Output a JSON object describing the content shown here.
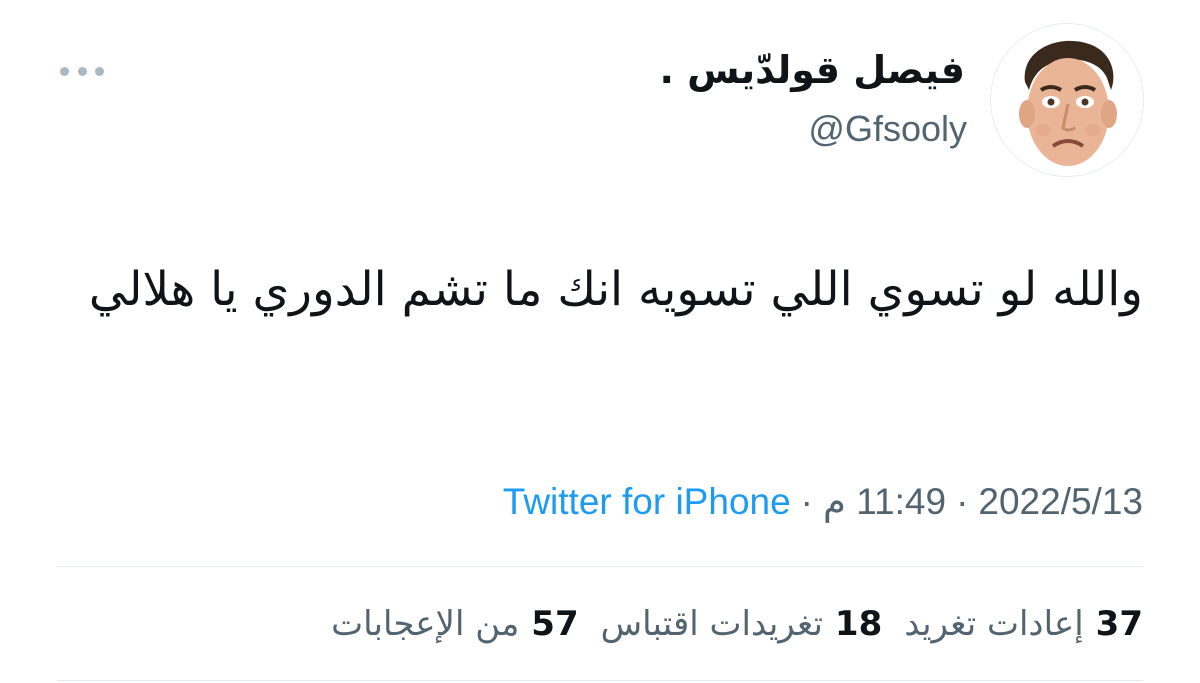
{
  "author": {
    "display_name": "فيصل قولدّيس .",
    "handle": "@Gfsooly",
    "avatar": "avatar-icon"
  },
  "tweet": {
    "text": "والله لو تسوي اللي تسويه انك ما تشم الدوري يا هلالي"
  },
  "meta": {
    "date": "2022/5/13",
    "separator": "·",
    "time": "11:49 م",
    "source": "Twitter for iPhone"
  },
  "stats": {
    "retweets_count": "37",
    "retweets_label": "إعادات تغريد",
    "quotes_count": "18",
    "quotes_label": "تغريدات اقتباس",
    "likes_count": "57",
    "likes_label": "من الإعجابات"
  },
  "colors": {
    "link": "#1d9bf0",
    "secondary_text": "#536471",
    "divider": "#e6ecf0"
  },
  "icons": {
    "more": "more-horizontal-icon"
  }
}
